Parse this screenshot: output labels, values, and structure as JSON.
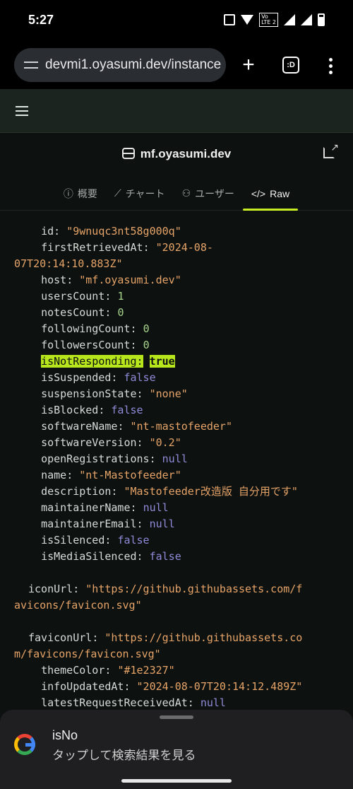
{
  "status_bar": {
    "time": "5:27",
    "volte_top": "Vo",
    "volte_bottom": "LTE 2"
  },
  "browser": {
    "url": "devmi1.oyasumi.dev/instance",
    "new_tab_label": "+",
    "tabs_label": ":D"
  },
  "instance": {
    "title": "mf.oyasumi.dev"
  },
  "tabs": [
    {
      "icon": "ⓘ",
      "label": "概要"
    },
    {
      "icon": "⟋",
      "label": "チャート"
    },
    {
      "icon": "⚇",
      "label": "ユーザー"
    },
    {
      "icon": "</>",
      "label": "Raw"
    }
  ],
  "raw": [
    {
      "indent": 1,
      "key": "id",
      "value": "\"9wnuqc3nt58g000q\"",
      "type": "s"
    },
    {
      "indent": 1,
      "key": "firstRetrievedAt",
      "value": "\"2024-08-",
      "type": "s",
      "cont": "07T20:14:10.883Z\""
    },
    {
      "indent": 1,
      "key": "host",
      "value": "\"mf.oyasumi.dev\"",
      "type": "s"
    },
    {
      "indent": 1,
      "key": "usersCount",
      "value": "1",
      "type": "n"
    },
    {
      "indent": 1,
      "key": "notesCount",
      "value": "0",
      "type": "n"
    },
    {
      "indent": 1,
      "key": "followingCount",
      "value": "0",
      "type": "n"
    },
    {
      "indent": 1,
      "key": "followersCount",
      "value": "0",
      "type": "n"
    },
    {
      "indent": 1,
      "key": "isNotResponding",
      "value": "true",
      "type": "hl"
    },
    {
      "indent": 1,
      "key": "isSuspended",
      "value": "false",
      "type": "b"
    },
    {
      "indent": 1,
      "key": "suspensionState",
      "value": "\"none\"",
      "type": "s"
    },
    {
      "indent": 1,
      "key": "isBlocked",
      "value": "false",
      "type": "b"
    },
    {
      "indent": 1,
      "key": "softwareName",
      "value": "\"nt-mastofeeder\"",
      "type": "s"
    },
    {
      "indent": 1,
      "key": "softwareVersion",
      "value": "\"0.2\"",
      "type": "s"
    },
    {
      "indent": 1,
      "key": "openRegistrations",
      "value": "null",
      "type": "nl"
    },
    {
      "indent": 1,
      "key": "name",
      "value": "\"nt-Mastofeeder\"",
      "type": "s"
    },
    {
      "indent": 1,
      "key": "description",
      "value": "\"Mastofeeder改造版 自分用です\"",
      "type": "s"
    },
    {
      "indent": 1,
      "key": "maintainerName",
      "value": "null",
      "type": "nl"
    },
    {
      "indent": 1,
      "key": "maintainerEmail",
      "value": "null",
      "type": "nl"
    },
    {
      "indent": 1,
      "key": "isSilenced",
      "value": "false",
      "type": "b"
    },
    {
      "indent": 1,
      "key": "isMediaSilenced",
      "value": "false",
      "type": "b"
    },
    {
      "gap": true
    },
    {
      "indent": 0,
      "key": "iconUrl",
      "value": "\"https://github.githubassets.com/f",
      "type": "s",
      "cont": "avicons/favicon.svg\""
    },
    {
      "gap": true
    },
    {
      "indent": 0,
      "key": "faviconUrl",
      "value": "\"https://github.githubassets.co",
      "type": "s",
      "cont": "m/favicons/favicon.svg\""
    },
    {
      "indent": 1,
      "key": "themeColor",
      "value": "\"#1e2327\"",
      "type": "s"
    },
    {
      "indent": 1,
      "key": "infoUpdatedAt",
      "value": "\"2024-08-07T20:14:12.489Z\"",
      "type": "s"
    },
    {
      "indent": 1,
      "key": "latestRequestReceivedAt",
      "value": "null",
      "type": "nl"
    }
  ],
  "suggestion": {
    "query": "isNo",
    "subtitle": "タップして検索結果を見る"
  },
  "colors": {
    "accent": "#c6ed24",
    "string": "#e6a468",
    "number": "#a8d58d",
    "boolean": "#8f8bd8"
  }
}
